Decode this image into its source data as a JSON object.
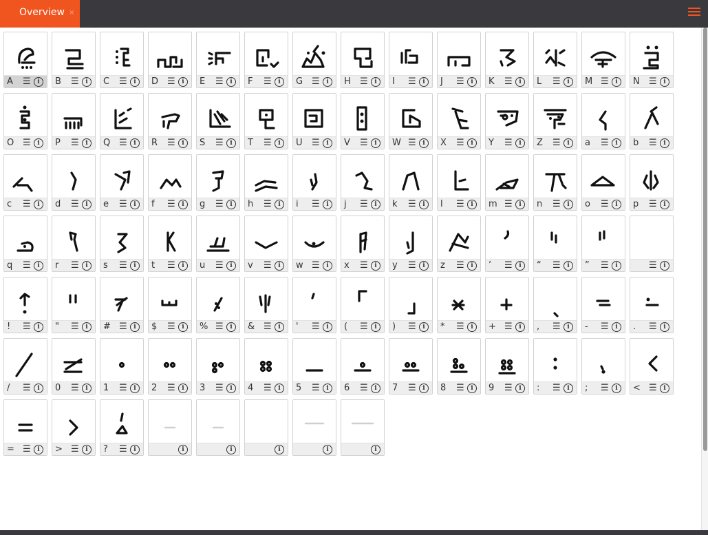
{
  "app": {
    "tab_label": "Overview",
    "tab_close": "×",
    "menu_icon": "hamburger-menu-icon",
    "accent_color": "#f0541f",
    "toolbar_color": "#3a3a3e"
  },
  "glyph_icons": {
    "lines": "☰",
    "info": "i"
  },
  "glyphs": [
    {
      "key": "A",
      "selected": true
    },
    {
      "key": "B"
    },
    {
      "key": "C"
    },
    {
      "key": "D"
    },
    {
      "key": "E"
    },
    {
      "key": "F"
    },
    {
      "key": "G"
    },
    {
      "key": "H"
    },
    {
      "key": "I"
    },
    {
      "key": "J"
    },
    {
      "key": "K"
    },
    {
      "key": "L"
    },
    {
      "key": "M"
    },
    {
      "key": "N"
    },
    {
      "key": "O"
    },
    {
      "key": "P"
    },
    {
      "key": "Q"
    },
    {
      "key": "R"
    },
    {
      "key": "S"
    },
    {
      "key": "T"
    },
    {
      "key": "U"
    },
    {
      "key": "V"
    },
    {
      "key": "W"
    },
    {
      "key": "X"
    },
    {
      "key": "Y"
    },
    {
      "key": "Z"
    },
    {
      "key": "a"
    },
    {
      "key": "b"
    },
    {
      "key": "c"
    },
    {
      "key": "d"
    },
    {
      "key": "e"
    },
    {
      "key": "f"
    },
    {
      "key": "g"
    },
    {
      "key": "h"
    },
    {
      "key": "i"
    },
    {
      "key": "j"
    },
    {
      "key": "k"
    },
    {
      "key": "l"
    },
    {
      "key": "m"
    },
    {
      "key": "n"
    },
    {
      "key": "o"
    },
    {
      "key": "p"
    },
    {
      "key": "q"
    },
    {
      "key": "r"
    },
    {
      "key": "s"
    },
    {
      "key": "t"
    },
    {
      "key": "u"
    },
    {
      "key": "v"
    },
    {
      "key": "w"
    },
    {
      "key": "x"
    },
    {
      "key": "y"
    },
    {
      "key": "z"
    },
    {
      "key": "’"
    },
    {
      "key": "“"
    },
    {
      "key": "”"
    },
    {
      "key": ""
    },
    {
      "key": "!"
    },
    {
      "key": "\""
    },
    {
      "key": "#"
    },
    {
      "key": "$"
    },
    {
      "key": "%"
    },
    {
      "key": "&"
    },
    {
      "key": "'"
    },
    {
      "key": "("
    },
    {
      "key": ")"
    },
    {
      "key": "*"
    },
    {
      "key": "+"
    },
    {
      "key": ","
    },
    {
      "key": "-"
    },
    {
      "key": "."
    },
    {
      "key": "/"
    },
    {
      "key": "0"
    },
    {
      "key": "1"
    },
    {
      "key": "2"
    },
    {
      "key": "3"
    },
    {
      "key": "4"
    },
    {
      "key": "5"
    },
    {
      "key": "6"
    },
    {
      "key": "7"
    },
    {
      "key": "8"
    },
    {
      "key": "9"
    },
    {
      "key": ":"
    },
    {
      "key": ";"
    },
    {
      "key": "<"
    },
    {
      "key": "="
    },
    {
      "key": ">"
    },
    {
      "key": "?"
    },
    {
      "key": "",
      "no_lines": true
    },
    {
      "key": "",
      "no_lines": true
    },
    {
      "key": "",
      "no_lines": true
    },
    {
      "key": "",
      "no_lines": true
    },
    {
      "key": "",
      "no_lines": true
    }
  ]
}
